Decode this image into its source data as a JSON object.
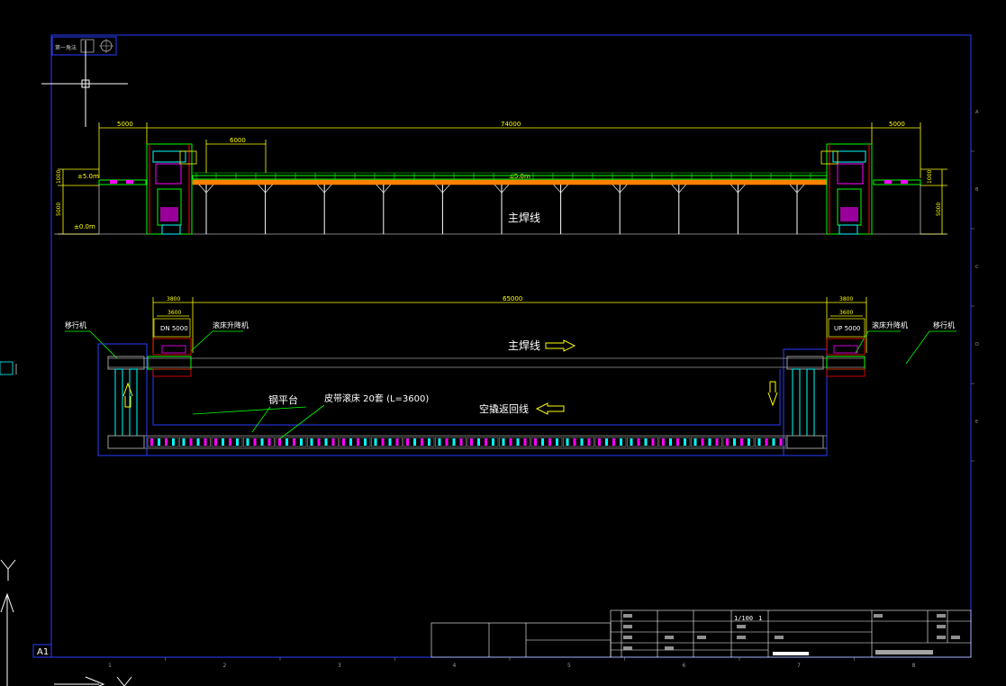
{
  "sheet": {
    "size_label": "A1",
    "border_color": "#2a3cff",
    "bottom_ruler": [
      "1",
      "2",
      "3",
      "4",
      "5",
      "6",
      "7",
      "8"
    ],
    "right_ruler": [
      "A",
      "B",
      "C",
      "D",
      "E"
    ]
  },
  "top_left_box": {
    "text": "第一角法"
  },
  "elevation": {
    "dim_left": "5000",
    "dim_total": "74000",
    "dim_right": "5000",
    "dim_inner": "6000",
    "level_high_left": "±5.0m",
    "level_high_mid": "±5.0m",
    "level_zero": "±0.0m",
    "vert_left_small": "1000",
    "vert_left_large": "5000",
    "vert_right_small": "1000",
    "vert_right_large": "5000",
    "line_label": "主焊线"
  },
  "plan": {
    "dim_total": "65000",
    "dim_left_outer": "3800",
    "dim_left_inner": "3600",
    "dim_right_outer": "3800",
    "dim_right_inner": "3600",
    "box_left": "DN 5000",
    "box_right": "UP 5000",
    "callout_left_outer": "移行机",
    "callout_left_inner": "滚床升降机",
    "callout_right_inner": "滚床升降机",
    "callout_right_outer": "移行机",
    "main_line": "主焊线",
    "return_line": "空撬返回线",
    "conveyor_label": "钢平台",
    "conveyor_spec": "皮带滚床 20套 (L=3600)"
  },
  "title_block": {
    "scale": "1/100",
    "sheet_no": "1"
  },
  "colors": {
    "yellow": "#ffff00",
    "white": "#ffffff",
    "green": "#00ff00",
    "orange": "#ff7f00",
    "magenta": "#ff00ff",
    "cyan": "#00ffff",
    "blue": "#2a3cff",
    "red": "#ff0000",
    "gray": "#9a9a9a"
  }
}
